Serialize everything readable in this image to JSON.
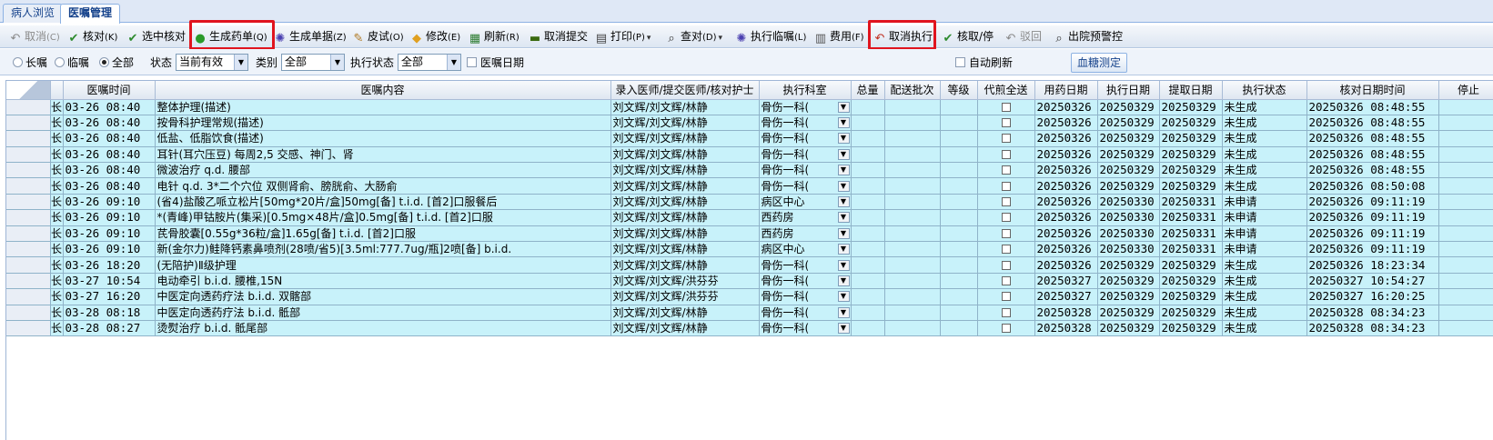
{
  "tabs": [
    {
      "label": "病人浏览"
    },
    {
      "label": "医嘱管理"
    }
  ],
  "toolbar": [
    {
      "label": "取消",
      "key": "(C)",
      "icon": "undo-icon",
      "color": "#8a8a8a",
      "disabled": true
    },
    {
      "label": "核对",
      "key": "(K)",
      "icon": "check-icon",
      "color": "#2e8b2e",
      "disabled": false
    },
    {
      "label": "选中核对",
      "key": "",
      "icon": "check-icon",
      "color": "#2e8b2e",
      "disabled": false
    },
    {
      "label": "生成药单",
      "key": "(Q)",
      "icon": "pills-icon",
      "color": "#2a9a2a",
      "disabled": false
    },
    {
      "label": "生成单据",
      "key": "(Z)",
      "icon": "gear-icon",
      "color": "#4a3fb0",
      "disabled": false
    },
    {
      "label": "皮试",
      "key": "(O)",
      "icon": "syringe-icon",
      "color": "#b07820",
      "disabled": false
    },
    {
      "label": "修改",
      "key": "(E)",
      "icon": "eraser-icon",
      "color": "#e0a020",
      "disabled": false
    },
    {
      "label": "刷新",
      "key": "(R)",
      "icon": "refresh-icon",
      "color": "#2e7d32",
      "disabled": false
    },
    {
      "label": "取消提交",
      "key": "",
      "icon": "stop-icon",
      "color": "#3a6a10",
      "disabled": false
    },
    {
      "label": "打印",
      "key": "(P)",
      "icon": "printer-icon",
      "color": "#444444",
      "disabled": false
    },
    {
      "label": "查对",
      "key": "(D)",
      "icon": "search-icon",
      "color": "#333333",
      "disabled": false
    },
    {
      "label": "执行临嘱",
      "key": "(L)",
      "icon": "gear-icon",
      "color": "#4a3fb0",
      "disabled": false
    },
    {
      "label": "费用",
      "key": "(F)",
      "icon": "calculator-icon",
      "color": "#555555",
      "disabled": false
    },
    {
      "label": "取消执行",
      "key": "",
      "icon": "undo-icon",
      "color": "#c03020",
      "disabled": false
    },
    {
      "label": "核取/停",
      "key": "",
      "icon": "check-icon",
      "color": "#2e8b2e",
      "disabled": false
    },
    {
      "label": "驳回",
      "key": "",
      "icon": "undo-icon",
      "color": "#8a8a8a",
      "disabled": true
    },
    {
      "label": "出院预警控",
      "key": "",
      "icon": "search-icon",
      "color": "#333333",
      "disabled": false
    }
  ],
  "filters": {
    "radio_long": "长嘱",
    "radio_temp": "临嘱",
    "radio_all": "全部",
    "status_label": "状态",
    "status_value": "当前有效",
    "category_label": "类别",
    "category_value": "全部",
    "exec_status_label": "执行状态",
    "exec_status_value": "全部",
    "order_date_label": "医嘱日期",
    "auto_refresh_label": "自动刷新",
    "blood_sugar_button": "血糖测定"
  },
  "grid": {
    "columns": [
      "医嘱时间",
      "医嘱内容",
      "录入医师/提交医师/核对护士",
      "执行科室",
      "总量",
      "配送批次",
      "等级",
      "代煎全送",
      "用药日期",
      "执行日期",
      "提取日期",
      "执行状态",
      "核对日期时间",
      "停止"
    ],
    "rows": [
      {
        "type": "长",
        "time": "03-26 08:40",
        "content": "整体护理(描述)",
        "doctors": "刘文辉/刘文辉/林静",
        "dept": "骨伤一科(",
        "use_date": "20250326",
        "exec_date": "20250329",
        "fetch_date": "20250329",
        "status": "未生成",
        "check_time": "20250326 08:48:55"
      },
      {
        "type": "长",
        "time": "03-26 08:40",
        "content": "按骨科护理常规(描述)",
        "doctors": "刘文辉/刘文辉/林静",
        "dept": "骨伤一科(",
        "use_date": "20250326",
        "exec_date": "20250329",
        "fetch_date": "20250329",
        "status": "未生成",
        "check_time": "20250326 08:48:55"
      },
      {
        "type": "长",
        "time": "03-26 08:40",
        "content": "低盐、低脂饮食(描述)",
        "doctors": "刘文辉/刘文辉/林静",
        "dept": "骨伤一科(",
        "use_date": "20250326",
        "exec_date": "20250329",
        "fetch_date": "20250329",
        "status": "未生成",
        "check_time": "20250326 08:48:55"
      },
      {
        "type": "长",
        "time": "03-26 08:40",
        "content": "耳针(耳穴压豆) 每周2,5  交感、神门、肾",
        "doctors": "刘文辉/刘文辉/林静",
        "dept": "骨伤一科(",
        "use_date": "20250326",
        "exec_date": "20250329",
        "fetch_date": "20250329",
        "status": "未生成",
        "check_time": "20250326 08:48:55"
      },
      {
        "type": "长",
        "time": "03-26 08:40",
        "content": "微波治疗 q.d.  腰部",
        "doctors": "刘文辉/刘文辉/林静",
        "dept": "骨伤一科(",
        "use_date": "20250326",
        "exec_date": "20250329",
        "fetch_date": "20250329",
        "status": "未生成",
        "check_time": "20250326 08:48:55"
      },
      {
        "type": "长",
        "time": "03-26 08:40",
        "content": "电针 q.d. 3*二个穴位 双侧肾俞、膀胱俞、大肠俞",
        "doctors": "刘文辉/刘文辉/林静",
        "dept": "骨伤一科(",
        "use_date": "20250326",
        "exec_date": "20250329",
        "fetch_date": "20250329",
        "status": "未生成",
        "check_time": "20250326 08:50:08"
      },
      {
        "type": "长",
        "time": "03-26 09:10",
        "content": "(省4)盐酸乙哌立松片[50mg*20片/盒]50mg[备]  t.i.d.  [首2]口服餐后",
        "doctors": "刘文辉/刘文辉/林静",
        "dept": "病区中心",
        "use_date": "20250326",
        "exec_date": "20250330",
        "fetch_date": "20250331",
        "status": "未申请",
        "check_time": "20250326 09:11:19"
      },
      {
        "type": "长",
        "time": "03-26 09:10",
        "content": "*(青峰)甲钴胺片(集采)[0.5mg×48片/盒]0.5mg[备]  t.i.d.  [首2]口服",
        "doctors": "刘文辉/刘文辉/林静",
        "dept": "西药房",
        "use_date": "20250326",
        "exec_date": "20250330",
        "fetch_date": "20250331",
        "status": "未申请",
        "check_time": "20250326 09:11:19"
      },
      {
        "type": "长",
        "time": "03-26 09:10",
        "content": "芪骨胶囊[0.55g*36粒/盒]1.65g[备]  t.i.d.  [首2]口服",
        "doctors": "刘文辉/刘文辉/林静",
        "dept": "西药房",
        "use_date": "20250326",
        "exec_date": "20250330",
        "fetch_date": "20250331",
        "status": "未申请",
        "check_time": "20250326 09:11:19"
      },
      {
        "type": "长",
        "time": "03-26 09:10",
        "content": "新(金尔力)鲑降钙素鼻喷剂(28喷/省5)[3.5ml:777.7ug/瓶]2喷[备]  b.i.d.",
        "doctors": "刘文辉/刘文辉/林静",
        "dept": "病区中心",
        "use_date": "20250326",
        "exec_date": "20250330",
        "fetch_date": "20250331",
        "status": "未申请",
        "check_time": "20250326 09:11:19"
      },
      {
        "type": "长",
        "time": "03-26 18:20",
        "content": "(无陪护)Ⅱ级护理",
        "doctors": "刘文辉/刘文辉/林静",
        "dept": "骨伤一科(",
        "use_date": "20250326",
        "exec_date": "20250329",
        "fetch_date": "20250329",
        "status": "未生成",
        "check_time": "20250326 18:23:34"
      },
      {
        "type": "长",
        "time": "03-27 10:54",
        "content": "电动牵引 b.i.d.  腰椎,15N",
        "doctors": "刘文辉/刘文辉/洪芬芬",
        "dept": "骨伤一科(",
        "use_date": "20250327",
        "exec_date": "20250329",
        "fetch_date": "20250329",
        "status": "未生成",
        "check_time": "20250327 10:54:27"
      },
      {
        "type": "长",
        "time": "03-27 16:20",
        "content": "中医定向透药疗法 b.i.d.  双髂部",
        "doctors": "刘文辉/刘文辉/洪芬芬",
        "dept": "骨伤一科(",
        "use_date": "20250327",
        "exec_date": "20250329",
        "fetch_date": "20250329",
        "status": "未生成",
        "check_time": "20250327 16:20:25"
      },
      {
        "type": "长",
        "time": "03-28 08:18",
        "content": "中医定向透药疗法 b.i.d.  骶部",
        "doctors": "刘文辉/刘文辉/林静",
        "dept": "骨伤一科(",
        "use_date": "20250328",
        "exec_date": "20250329",
        "fetch_date": "20250329",
        "status": "未生成",
        "check_time": "20250328 08:34:23"
      },
      {
        "type": "长",
        "time": "03-28 08:27",
        "content": "烫熨治疗 b.i.d.  骶尾部",
        "doctors": "刘文辉/刘文辉/林静",
        "dept": "骨伤一科(",
        "use_date": "20250328",
        "exec_date": "20250329",
        "fetch_date": "20250329",
        "status": "未生成",
        "check_time": "20250328 08:34:23"
      }
    ]
  },
  "colors": {
    "row_bg": "#c8f2fa",
    "highlight_border": "#e0141e",
    "tab_text": "#15428b"
  }
}
